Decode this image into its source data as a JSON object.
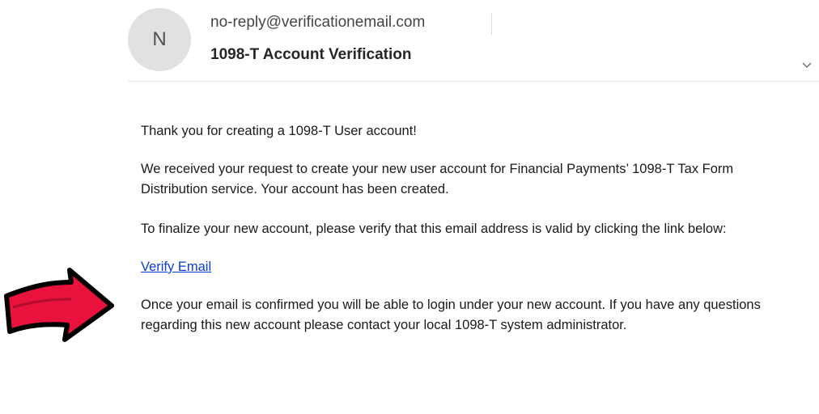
{
  "email": {
    "avatar_initial": "N",
    "sender": "no-reply@verificationemail.com",
    "subject": "1098-T Account Verification"
  },
  "message": {
    "greeting": "Thank you for creating a 1098-T User account!",
    "paragraph_received": "We received your request to create your new user account for Financial Payments’ 1098-T Tax Form Distribution service. Your account has been created.",
    "paragraph_finalize": "To finalize your new account, please verify that this email address is valid by clicking the link below:",
    "verify_link": "Verify Email",
    "paragraph_confirmed": "Once your email is confirmed you will be able to login under your new account. If you have any questions regarding this new account please contact your local 1098-T system administrator."
  },
  "icons": {
    "expand": "chevron-down-icon",
    "pointer": "arrow-right-icon"
  },
  "colors": {
    "avatar_bg": "#e1e1e1",
    "link": "#0b3dd8",
    "arrow_fill": "#e8123c",
    "arrow_outline": "#000000"
  }
}
